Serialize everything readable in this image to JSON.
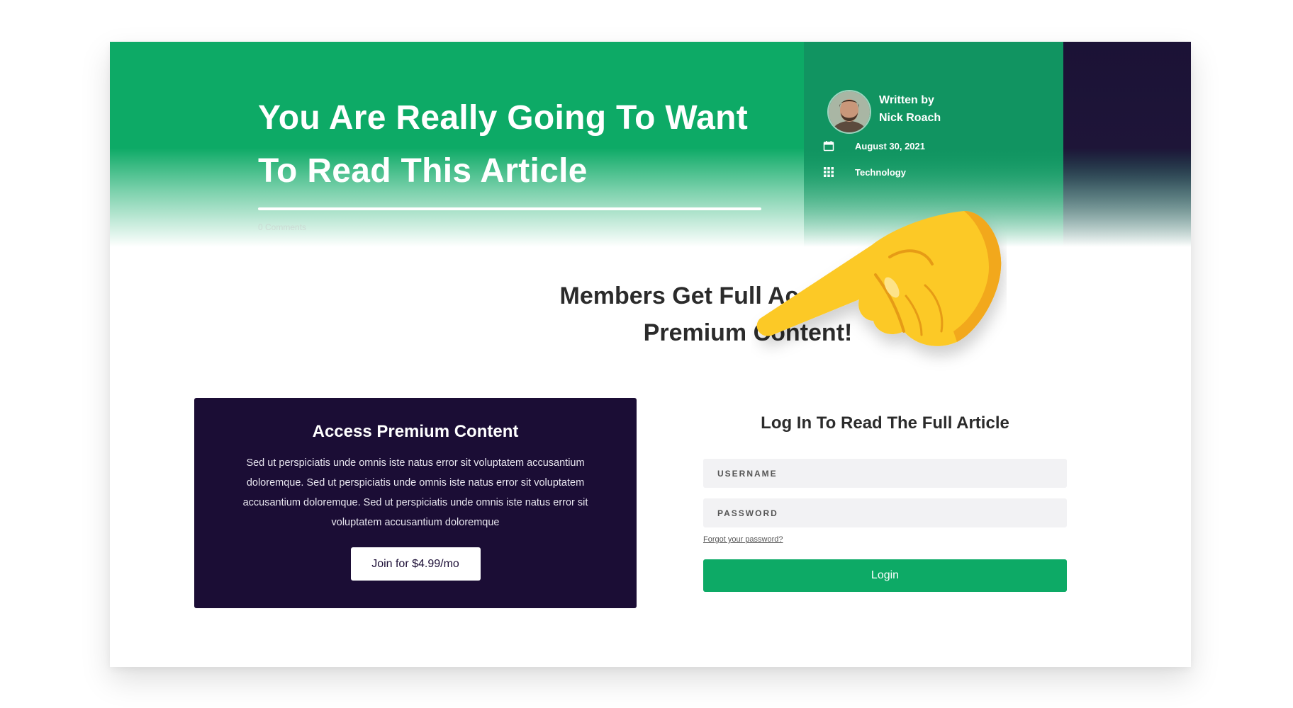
{
  "hero": {
    "title": "You Are Really Going To Want To Read This Article",
    "comments": "0 Comments"
  },
  "author": {
    "written_by": "Written by",
    "name": "Nick Roach"
  },
  "meta": {
    "date": "August 30, 2021",
    "category": "Technology"
  },
  "members_heading": "Members Get Full Access To Our Premium Content!",
  "premium": {
    "title": "Access Premium Content",
    "body": "Sed ut perspiciatis unde omnis iste natus error sit voluptatem accusantium doloremque. Sed ut perspiciatis unde omnis iste natus error sit voluptatem accusantium doloremque. Sed ut perspiciatis unde omnis iste natus error sit voluptatem accusantium doloremque",
    "join_label": "Join for $4.99/mo"
  },
  "login": {
    "title": "Log In To Read The Full Article",
    "username_placeholder": "USERNAME",
    "password_placeholder": "PASSWORD",
    "forgot_label": "Forgot your password?",
    "login_label": "Login"
  },
  "icons": {
    "calendar": "calendar-icon",
    "category": "grid-icon",
    "pointer": "pointing-hand-icon"
  },
  "colors": {
    "brand_green": "#0daa66",
    "dark_purple": "#1b0d35"
  }
}
